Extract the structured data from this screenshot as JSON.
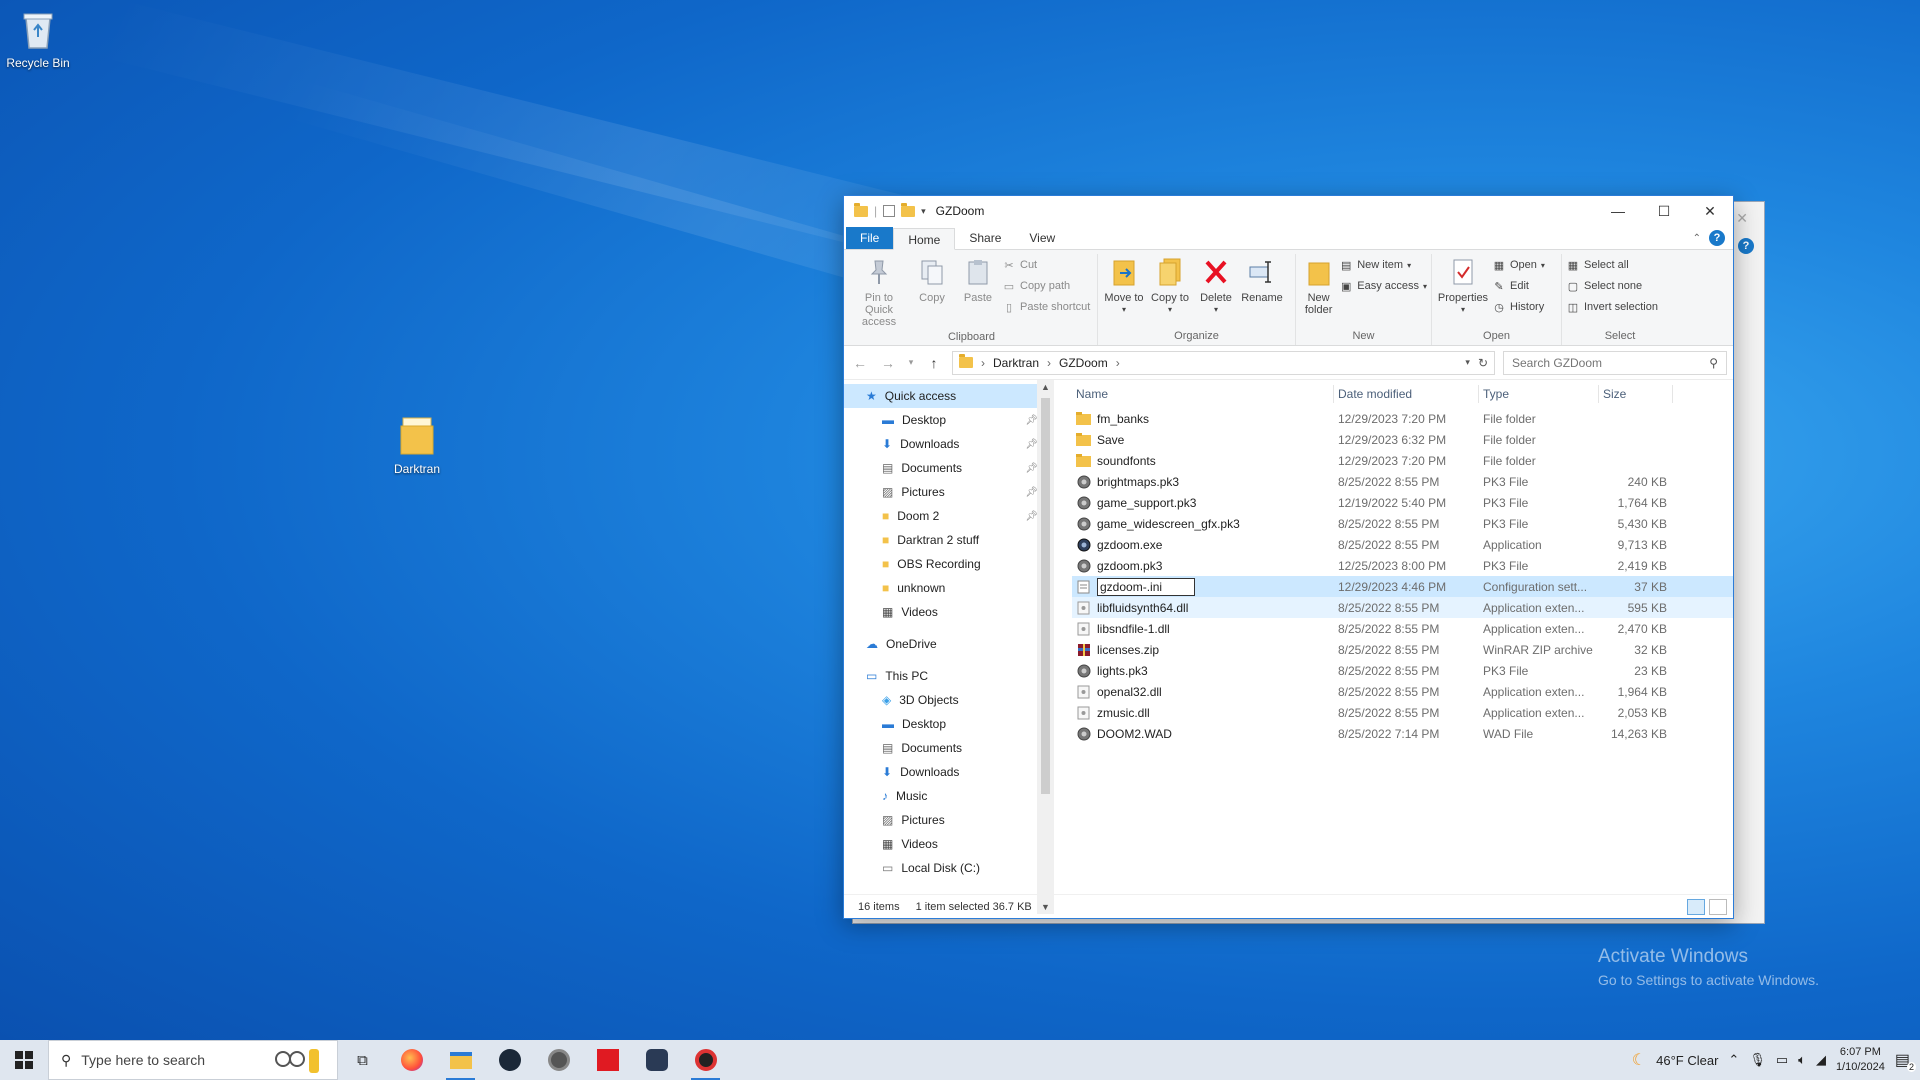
{
  "desktop": {
    "icons": [
      {
        "label": "Recycle Bin"
      },
      {
        "label": "Darktran"
      }
    ],
    "watermark": {
      "line1": "Activate Windows",
      "line2": "Go to Settings to activate Windows."
    }
  },
  "window": {
    "title": "GZDoom",
    "tabs": [
      "File",
      "Home",
      "Share",
      "View"
    ],
    "ribbon": {
      "clipboard": {
        "title": "Clipboard",
        "pin": "Pin to Quick access",
        "copy": "Copy",
        "paste": "Paste",
        "cut": "Cut",
        "copy_path": "Copy path",
        "paste_shortcut": "Paste shortcut"
      },
      "organize": {
        "title": "Organize",
        "move_to": "Move to",
        "copy_to": "Copy to",
        "delete": "Delete",
        "rename": "Rename"
      },
      "new": {
        "title": "New",
        "new_folder": "New folder",
        "new_item": "New item",
        "easy_access": "Easy access"
      },
      "open": {
        "title": "Open",
        "properties": "Properties",
        "open": "Open",
        "edit": "Edit",
        "history": "History"
      },
      "select": {
        "title": "Select",
        "select_all": "Select all",
        "select_none": "Select none",
        "invert": "Invert selection"
      }
    },
    "address": {
      "crumbs": [
        "Darktran",
        "GZDoom"
      ]
    },
    "search": {
      "placeholder": "Search GZDoom"
    },
    "nav": {
      "quick_access": "Quick access",
      "quick_items": [
        {
          "label": "Desktop",
          "icon": "desktop-icon",
          "pinned": true
        },
        {
          "label": "Downloads",
          "icon": "download-icon",
          "pinned": true
        },
        {
          "label": "Documents",
          "icon": "document-icon",
          "pinned": true
        },
        {
          "label": "Pictures",
          "icon": "picture-icon",
          "pinned": true
        },
        {
          "label": "Doom 2",
          "icon": "folder-icon",
          "pinned": true
        },
        {
          "label": "Darktran 2 stuff",
          "icon": "folder-icon",
          "pinned": false
        },
        {
          "label": "OBS Recording",
          "icon": "folder-icon",
          "pinned": false
        },
        {
          "label": "unknown",
          "icon": "folder-icon",
          "pinned": false
        },
        {
          "label": "Videos",
          "icon": "video-icon",
          "pinned": false
        }
      ],
      "onedrive": "OneDrive",
      "this_pc": "This PC",
      "pc_items": [
        {
          "label": "3D Objects",
          "icon": "cube-icon"
        },
        {
          "label": "Desktop",
          "icon": "desktop-icon"
        },
        {
          "label": "Documents",
          "icon": "document-icon"
        },
        {
          "label": "Downloads",
          "icon": "download-icon"
        },
        {
          "label": "Music",
          "icon": "music-icon"
        },
        {
          "label": "Pictures",
          "icon": "picture-icon"
        },
        {
          "label": "Videos",
          "icon": "video-icon"
        },
        {
          "label": "Local Disk (C:)",
          "icon": "drive-icon"
        }
      ]
    },
    "columns": {
      "name": "Name",
      "date": "Date modified",
      "type": "Type",
      "size": "Size"
    },
    "files": [
      {
        "name": "fm_banks",
        "date": "12/29/2023 7:20 PM",
        "type": "File folder",
        "size": "",
        "icon": "folder"
      },
      {
        "name": "Save",
        "date": "12/29/2023 6:32 PM",
        "type": "File folder",
        "size": "",
        "icon": "folder"
      },
      {
        "name": "soundfonts",
        "date": "12/29/2023 7:20 PM",
        "type": "File folder",
        "size": "",
        "icon": "folder"
      },
      {
        "name": "brightmaps.pk3",
        "date": "8/25/2022 8:55 PM",
        "type": "PK3 File",
        "size": "240 KB",
        "icon": "pk3"
      },
      {
        "name": "game_support.pk3",
        "date": "12/19/2022 5:40 PM",
        "type": "PK3 File",
        "size": "1,764 KB",
        "icon": "pk3"
      },
      {
        "name": "game_widescreen_gfx.pk3",
        "date": "8/25/2022 8:55 PM",
        "type": "PK3 File",
        "size": "5,430 KB",
        "icon": "pk3"
      },
      {
        "name": "gzdoom.exe",
        "date": "8/25/2022 8:55 PM",
        "type": "Application",
        "size": "9,713 KB",
        "icon": "exe"
      },
      {
        "name": "gzdoom.pk3",
        "date": "12/25/2023 8:00 PM",
        "type": "PK3 File",
        "size": "2,419 KB",
        "icon": "pk3"
      },
      {
        "name": "gzdoom-.ini",
        "date": "12/29/2023 4:46 PM",
        "type": "Configuration sett...",
        "size": "37 KB",
        "icon": "ini",
        "selected": true,
        "renaming": true
      },
      {
        "name": "libfluidsynth64.dll",
        "date": "8/25/2022 8:55 PM",
        "type": "Application exten...",
        "size": "595 KB",
        "icon": "dll",
        "hover": true
      },
      {
        "name": "libsndfile-1.dll",
        "date": "8/25/2022 8:55 PM",
        "type": "Application exten...",
        "size": "2,470 KB",
        "icon": "dll"
      },
      {
        "name": "licenses.zip",
        "date": "8/25/2022 8:55 PM",
        "type": "WinRAR ZIP archive",
        "size": "32 KB",
        "icon": "zip"
      },
      {
        "name": "lights.pk3",
        "date": "8/25/2022 8:55 PM",
        "type": "PK3 File",
        "size": "23 KB",
        "icon": "pk3"
      },
      {
        "name": "openal32.dll",
        "date": "8/25/2022 8:55 PM",
        "type": "Application exten...",
        "size": "1,964 KB",
        "icon": "dll"
      },
      {
        "name": "zmusic.dll",
        "date": "8/25/2022 8:55 PM",
        "type": "Application exten...",
        "size": "2,053 KB",
        "icon": "dll"
      },
      {
        "name": "DOOM2.WAD",
        "date": "8/25/2022 7:14 PM",
        "type": "WAD File",
        "size": "14,263 KB",
        "icon": "pk3"
      }
    ],
    "status": {
      "count": "16 items",
      "selection": "1 item selected  36.7 KB"
    }
  },
  "taskbar": {
    "search_placeholder": "Type here to search",
    "weather": "46°F  Clear",
    "time": "6:07 PM",
    "date": "1/10/2024",
    "notifications": "2"
  },
  "colors": {
    "accent": "#1979ca",
    "selection": "#cce8ff",
    "folder": "#f3c24a"
  }
}
